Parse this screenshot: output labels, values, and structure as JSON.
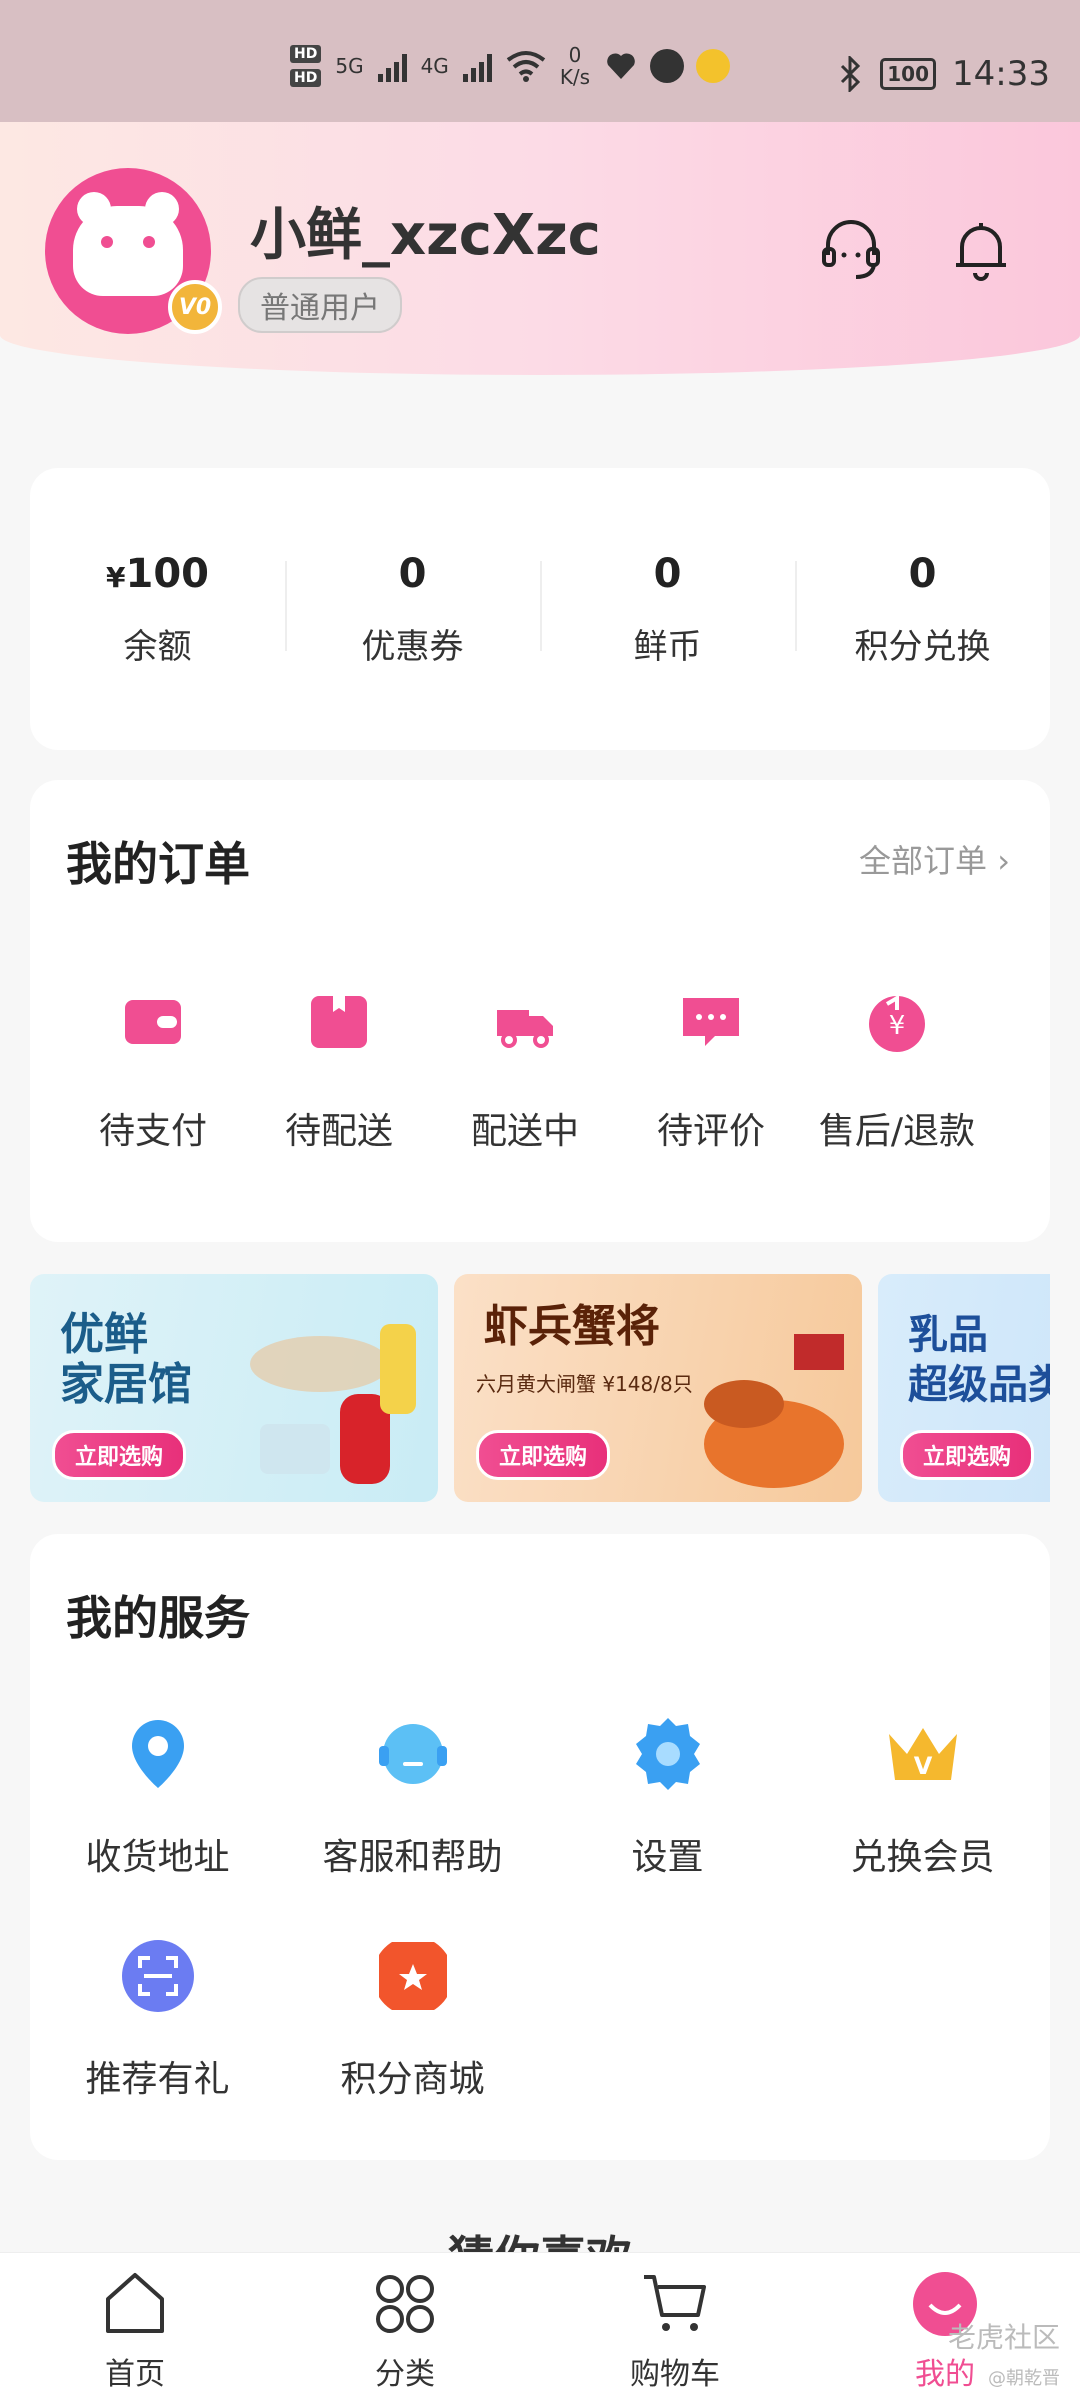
{
  "status_bar": {
    "hd1": "HD",
    "hd2": "HD",
    "net1": "5G",
    "net2": "4G",
    "speed_value": "0",
    "speed_unit": "K/s",
    "battery": "100",
    "time": "14:33"
  },
  "profile": {
    "username": "小鲜_xzcXzc",
    "user_type": "普通用户",
    "vip_level": "V0"
  },
  "stats": [
    {
      "currency": "¥",
      "value": "100",
      "label": "余额"
    },
    {
      "currency": "",
      "value": "0",
      "label": "优惠券"
    },
    {
      "currency": "",
      "value": "0",
      "label": "鲜币"
    },
    {
      "currency": "",
      "value": "0",
      "label": "积分兑换"
    }
  ],
  "orders": {
    "title": "我的订单",
    "all_label": "全部订单",
    "items": [
      {
        "label": "待支付",
        "icon": "wallet-icon"
      },
      {
        "label": "待配送",
        "icon": "box-icon"
      },
      {
        "label": "配送中",
        "icon": "delivery-truck-icon"
      },
      {
        "label": "待评价",
        "icon": "comment-icon"
      },
      {
        "label": "售后/退款",
        "icon": "refund-icon"
      }
    ]
  },
  "banners": [
    {
      "title1": "优鲜",
      "title2": "家居馆",
      "sub": "",
      "cta": "立即选购"
    },
    {
      "title1": "虾兵蟹将",
      "title2": "",
      "sub": "六月黄大闸蟹 ¥148/8只",
      "cta": "立即选购"
    },
    {
      "title1": "乳品",
      "title2": "超级品类",
      "sub": "",
      "cta": "立即选购"
    }
  ],
  "services": {
    "title": "我的服务",
    "items": [
      {
        "label": "收货地址",
        "icon": "location-pin-icon"
      },
      {
        "label": "客服和帮助",
        "icon": "customer-service-icon"
      },
      {
        "label": "设置",
        "icon": "settings-gear-icon"
      },
      {
        "label": "兑换会员",
        "icon": "crown-icon"
      },
      {
        "label": "推荐有礼",
        "icon": "scan-icon"
      },
      {
        "label": "积分商城",
        "icon": "shop-icon"
      }
    ]
  },
  "guess_title": "猜你喜欢",
  "tabbar": [
    {
      "label": "首页",
      "icon": "home-icon"
    },
    {
      "label": "分类",
      "icon": "category-icon"
    },
    {
      "label": "购物车",
      "icon": "cart-icon"
    },
    {
      "label": "我的",
      "icon": "profile-icon"
    }
  ],
  "watermark": "老虎社区",
  "watermark_sub": "@朝乾晋",
  "colors": {
    "accent": "#f04e92",
    "header_start": "#fde8e3",
    "header_end": "#fbc7db"
  }
}
